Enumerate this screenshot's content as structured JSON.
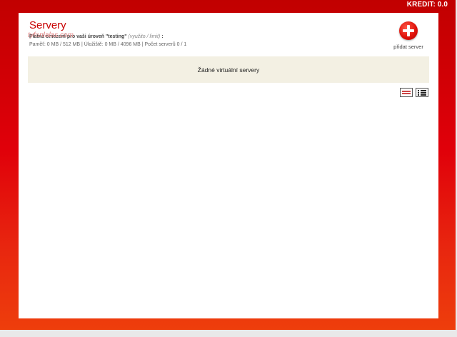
{
  "header": {
    "credit_label": "KREDIT: 0.0"
  },
  "page": {
    "title": "Servery",
    "watermark": "tyfonlalas.com"
  },
  "limits": {
    "title_prefix": "Platná omezení pro vaši úroveň \"testing\"",
    "title_hint": "(využito / limit)",
    "title_suffix": ":",
    "values": "Paměť: 0 MB / 512 MB | Úložiště: 0 MB / 4096 MB | Počet serverů 0 / 1"
  },
  "actions": {
    "add_server_label": "přidat server",
    "add_server_icon": "plus-circle-icon"
  },
  "servers": {
    "empty_message": "Žádné virtuální servery"
  },
  "view_toggle": {
    "grid_icon": "grid-view-icon",
    "list_icon": "list-view-icon"
  },
  "colors": {
    "brand_red": "#e0000a",
    "empty_bg": "#f3f0e3"
  }
}
